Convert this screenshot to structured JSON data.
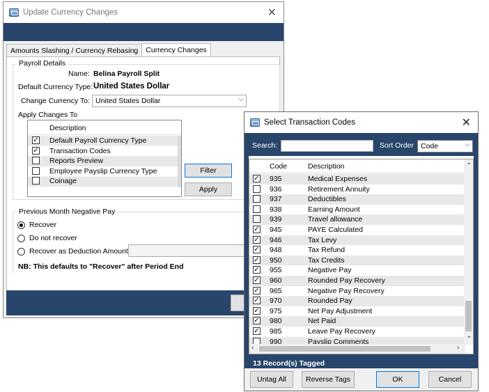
{
  "update_window": {
    "title": "Update Currency Changes",
    "tabs": [
      "Amounts Slashing / Currency Rebasing",
      "Currency Changes"
    ],
    "payroll_details": {
      "group_label": "Payroll Details",
      "name_label": "Name:",
      "name_value": "Belina Payroll Split",
      "default_currency_label": "Default Currency Type:",
      "default_currency_value": "United States Dollar",
      "change_currency_label": "Change Currency To:",
      "change_currency_value": "United States Dollar"
    },
    "apply_changes": {
      "label": "Apply Changes To",
      "column_header": "Description",
      "items": [
        {
          "label": "Default Payroll Currency Type",
          "checked": true
        },
        {
          "label": "Transaction Codes",
          "checked": true
        },
        {
          "label": "Reports Preview",
          "checked": false
        },
        {
          "label": "Employee Payslip Currency Type",
          "checked": false
        },
        {
          "label": "Coinage",
          "checked": false
        }
      ],
      "filter_button": "Filter",
      "apply_button": "Apply"
    },
    "negative_pay": {
      "group_label": "Previous Month Negative Pay",
      "options": [
        "Recover",
        "Do not recover",
        "Recover as Deduction Amount"
      ],
      "selected": "Recover",
      "note": "NB: This defaults to \"Recover\" after Period End"
    }
  },
  "select_window": {
    "title": "Select Transaction Codes",
    "search_label": "Search:",
    "search_value": "",
    "sort_label": "Sort Order",
    "sort_value": "Code",
    "columns": {
      "code": "Code",
      "description": "Description"
    },
    "rows": [
      {
        "code": "935",
        "description": "Medical Expenses",
        "checked": true
      },
      {
        "code": "936",
        "description": "Retirement Annuity",
        "checked": false
      },
      {
        "code": "937",
        "description": "Deductibles",
        "checked": false
      },
      {
        "code": "938",
        "description": "Earning Amount",
        "checked": false
      },
      {
        "code": "939",
        "description": "Travel allowance",
        "checked": false
      },
      {
        "code": "945",
        "description": "PAYE Calculated",
        "checked": true
      },
      {
        "code": "946",
        "description": "Tax Levy",
        "checked": true
      },
      {
        "code": "948",
        "description": "Tax Refund",
        "checked": true
      },
      {
        "code": "950",
        "description": "Tax Credits",
        "checked": true
      },
      {
        "code": "955",
        "description": "Negative Pay",
        "checked": true
      },
      {
        "code": "960",
        "description": "Rounded Pay Recovery",
        "checked": true
      },
      {
        "code": "965",
        "description": "Negative Pay Recovery",
        "checked": true
      },
      {
        "code": "970",
        "description": "Rounded Pay",
        "checked": true
      },
      {
        "code": "975",
        "description": "Net Pay Adjustment",
        "checked": true
      },
      {
        "code": "980",
        "description": "Net Paid",
        "checked": true
      },
      {
        "code": "985",
        "description": "Leave Pay Recovery",
        "checked": true
      },
      {
        "code": "990",
        "description": "Payslip Comments",
        "checked": false
      }
    ],
    "status": "13 Record(s) Tagged",
    "buttons": {
      "untag_all": "Untag All",
      "reverse_tags": "Reverse Tags",
      "ok": "OK",
      "cancel": "Cancel"
    }
  },
  "icons": {
    "app": "app-window-icon",
    "close": "close-icon",
    "checkbox_checked": "check-icon",
    "dropdown": "chevron-down-icon"
  },
  "colors": {
    "navy_band": "#28466b",
    "window_bg": "#f0f0f0",
    "row_stripe": "#e8e8e8",
    "focus_border": "#0078d7"
  }
}
